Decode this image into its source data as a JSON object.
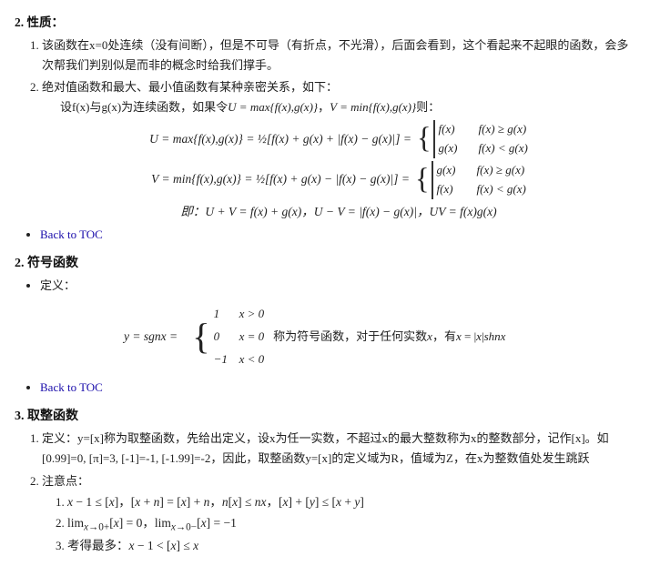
{
  "section2": {
    "title": "2. 性质：",
    "items": [
      {
        "num": "1.",
        "text": "该函数在x=0处连续（没有间断），但是不可导（有折点，不光滑），后面会看到，这个看起来不起眼的函数，会多次帮我们判别似是而非的概念时给我们撑手。"
      },
      {
        "num": "2.",
        "intro": "绝对值函数和最大、最小值函数有某种亲密关系，如下：",
        "setting": "设f(x)与g(x)为连续函数，如果令U = max{f(x),g(x)}，V = min{f(x),g(x)}则：",
        "formula_U": "U = max{f(x),g(x)} = ½[f(x)+g(x)+|f(x)−g(x)|]",
        "formula_V": "V = min{f(x),g(x)} = ½[f(x)+g(x)−|f(x)−g(x)|]",
        "conclusion": "即：U + V = f(x) + g(x)，U − V = |f(x) − g(x)|，UV = f(x)g(x)"
      }
    ],
    "back_to_toc": "Back to TOC"
  },
  "section_sign": {
    "num": "2.",
    "title": "符号函数",
    "definition_label": "定义：",
    "definition_intro": "",
    "formula_sgnx": "y = sgnx",
    "pieces": [
      {
        "val": "1",
        "cond": "x > 0"
      },
      {
        "val": "0",
        "cond": "x = 0"
      },
      {
        "val": "−1",
        "cond": "x < 0"
      }
    ],
    "note": "称为符号函数，对于任何实数x，有x = |x|shnx",
    "back_to_toc": "Back to TOC"
  },
  "section_floor": {
    "num": "3.",
    "title": "取整函数",
    "items": [
      {
        "num": "1.",
        "text": "定义：y=[x]称为取整函数，先给出定义，设x为任一实数，不超过x的最大整数称为x的整数部分，记作[x]。如[0.99]=0, [π]=3, [-1]=-1, [-1.99]=-2，因此，取整函数y=[x]的定义域为R，值域为Z，在x为整数值处发生跳跃"
      },
      {
        "num": "2.",
        "sub_label": "注意点：",
        "sub_items": [
          {
            "num": "1.",
            "text": "x − 1 ≤ [x]，[x + n] = [x] + n，n[x] ≤ nx，[x] + [y] ≤ [x + y]"
          },
          {
            "num": "2.",
            "text": "lim_{x→0+}[x] = 0，lim_{x→0-}[x] = −1"
          },
          {
            "num": "3.",
            "text": "考得最多：x − 1 < [x] ≤ x"
          }
        ]
      }
    ]
  }
}
